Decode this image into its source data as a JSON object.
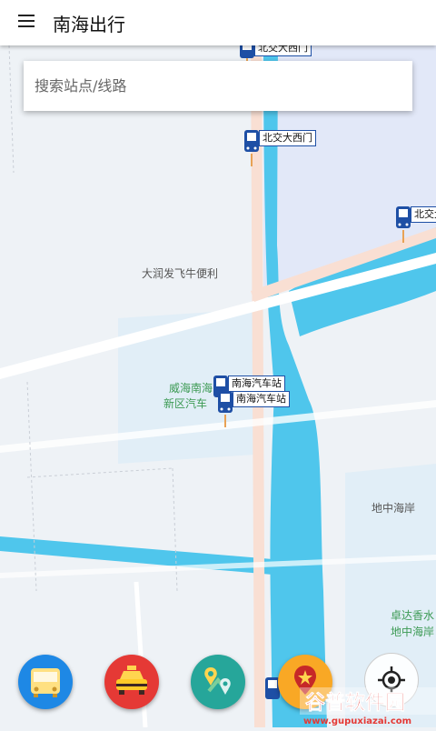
{
  "app_bar": {
    "title": "南海出行",
    "menu_icon": "menu-icon"
  },
  "search": {
    "placeholder": "搜索站点/线路",
    "value": ""
  },
  "stops": [
    {
      "label": "北交大西门"
    },
    {
      "label": "北交大西门"
    },
    {
      "label": "北交大"
    },
    {
      "label": "南海汽车站"
    },
    {
      "label": "南海汽车站"
    }
  ],
  "map_labels": {
    "poi1": "大润发飞牛便利",
    "poi2_line1": "威海南海",
    "poi2_line2": "新区汽车",
    "poi3": "地中海岸",
    "poi4_line1": "卓达香水",
    "poi4_line2": "地中海岸"
  },
  "fabs": [
    {
      "name": "bus-button",
      "color": "#1e88e5"
    },
    {
      "name": "taxi-button",
      "color": "#e53935"
    },
    {
      "name": "route-button",
      "color": "#26a69a"
    },
    {
      "name": "favorite-button",
      "color": "#f9a825"
    }
  ],
  "locate": {
    "icon": "locate-icon"
  },
  "watermark": {
    "line1": "谷普软件园",
    "line2": "www.gupuxiazai.com"
  },
  "colors": {
    "water": "#4fc6ec",
    "road": "#f9dfd3",
    "stop_blue": "#1e4fa5"
  }
}
